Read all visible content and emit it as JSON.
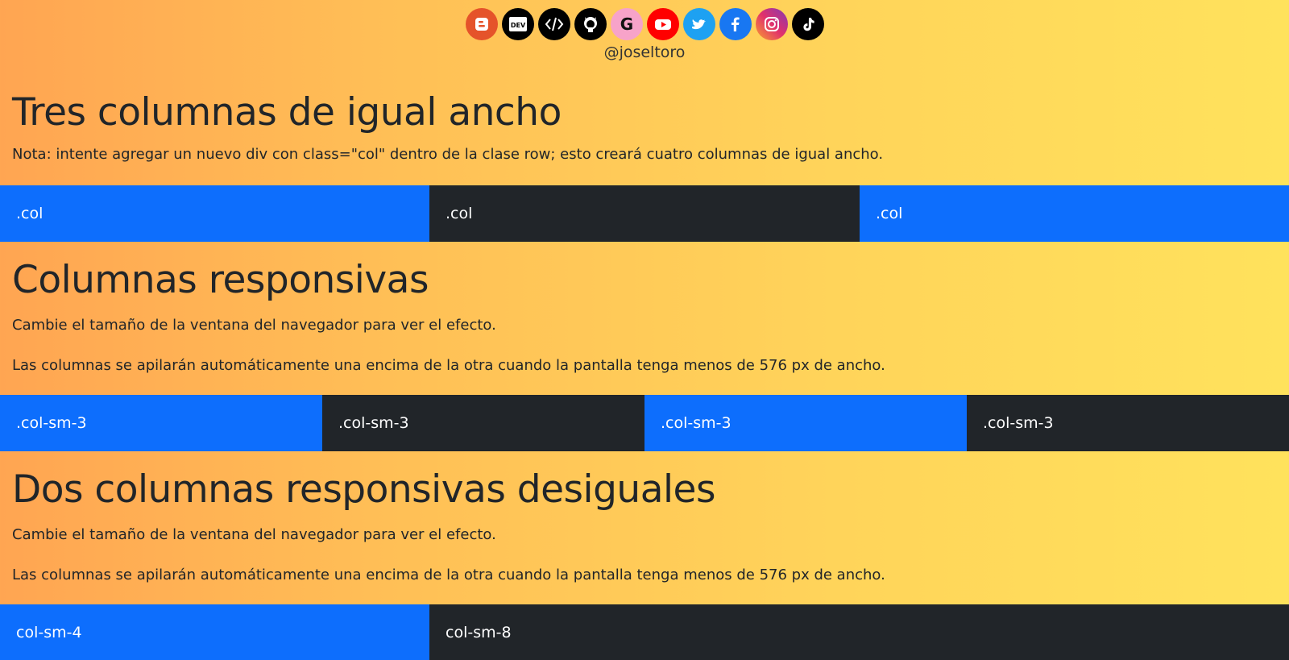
{
  "social": [
    {
      "name": "blogger-icon",
      "glyph": "B",
      "bg": "#e5532a"
    },
    {
      "name": "dev-icon",
      "glyph": "DEV",
      "bg": "#000000"
    },
    {
      "name": "code-icon",
      "glyph": "/>",
      "bg": "#000000"
    },
    {
      "name": "github-icon",
      "glyph": "GH",
      "bg": "#000000"
    },
    {
      "name": "google-icon",
      "glyph": "G",
      "bg": "#f7a3c9"
    },
    {
      "name": "youtube-icon",
      "glyph": "▶",
      "bg": "#ff0000"
    },
    {
      "name": "twitter-icon",
      "glyph": "t",
      "bg": "#1da1f2"
    },
    {
      "name": "facebook-icon",
      "glyph": "f",
      "bg": "#1877f2"
    },
    {
      "name": "instagram-icon",
      "glyph": "◎",
      "bg": "#c13584"
    },
    {
      "name": "tiktok-icon",
      "glyph": "♪",
      "bg": "#000000"
    }
  ],
  "handle": "@joseltoro",
  "section1": {
    "title": "Tres columnas de igual ancho",
    "note": "Nota: intente agregar un nuevo div con class=\"col\" dentro de la clase row; esto creará cuatro columnas de igual ancho.",
    "cols": [
      ".col",
      ".col",
      ".col"
    ]
  },
  "section2": {
    "title": "Columnas responsivas",
    "text1": "Cambie el tamaño de la ventana del navegador para ver el efecto.",
    "text2": "Las columnas se apilarán automáticamente una encima de la otra cuando la pantalla tenga menos de 576 px de ancho.",
    "cols": [
      ".col-sm-3",
      ".col-sm-3",
      ".col-sm-3",
      ".col-sm-3"
    ]
  },
  "section3": {
    "title": "Dos columnas responsivas desiguales",
    "text1": "Cambie el tamaño de la ventana del navegador para ver el efecto.",
    "text2": "Las columnas se apilarán automáticamente una encima de la otra cuando la pantalla tenga menos de 576 px de ancho.",
    "cols": [
      "col-sm-4",
      "col-sm-8"
    ]
  },
  "colors": {
    "blue": "#0d6efd",
    "dark": "#212529"
  }
}
